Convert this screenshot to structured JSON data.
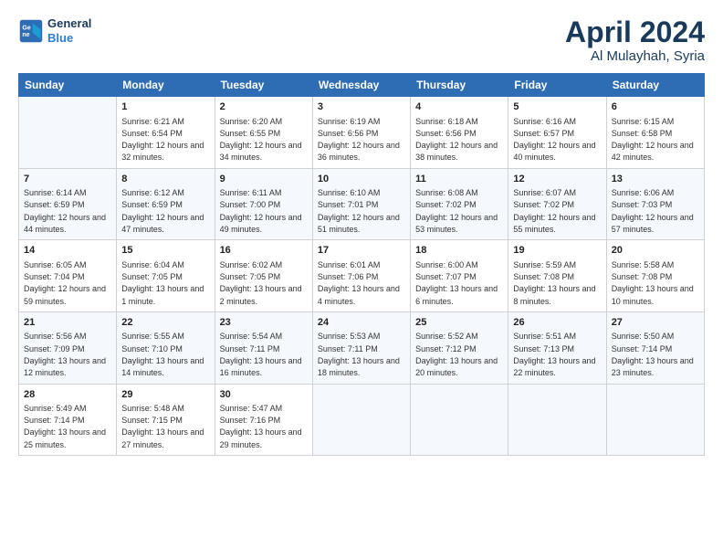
{
  "logo": {
    "line1": "General",
    "line2": "Blue"
  },
  "title": "April 2024",
  "subtitle": "Al Mulayhah, Syria",
  "days_header": [
    "Sunday",
    "Monday",
    "Tuesday",
    "Wednesday",
    "Thursday",
    "Friday",
    "Saturday"
  ],
  "weeks": [
    [
      {
        "day": "",
        "sunrise": "",
        "sunset": "",
        "daylight": ""
      },
      {
        "day": "1",
        "sunrise": "Sunrise: 6:21 AM",
        "sunset": "Sunset: 6:54 PM",
        "daylight": "Daylight: 12 hours and 32 minutes."
      },
      {
        "day": "2",
        "sunrise": "Sunrise: 6:20 AM",
        "sunset": "Sunset: 6:55 PM",
        "daylight": "Daylight: 12 hours and 34 minutes."
      },
      {
        "day": "3",
        "sunrise": "Sunrise: 6:19 AM",
        "sunset": "Sunset: 6:56 PM",
        "daylight": "Daylight: 12 hours and 36 minutes."
      },
      {
        "day": "4",
        "sunrise": "Sunrise: 6:18 AM",
        "sunset": "Sunset: 6:56 PM",
        "daylight": "Daylight: 12 hours and 38 minutes."
      },
      {
        "day": "5",
        "sunrise": "Sunrise: 6:16 AM",
        "sunset": "Sunset: 6:57 PM",
        "daylight": "Daylight: 12 hours and 40 minutes."
      },
      {
        "day": "6",
        "sunrise": "Sunrise: 6:15 AM",
        "sunset": "Sunset: 6:58 PM",
        "daylight": "Daylight: 12 hours and 42 minutes."
      }
    ],
    [
      {
        "day": "7",
        "sunrise": "Sunrise: 6:14 AM",
        "sunset": "Sunset: 6:59 PM",
        "daylight": "Daylight: 12 hours and 44 minutes."
      },
      {
        "day": "8",
        "sunrise": "Sunrise: 6:12 AM",
        "sunset": "Sunset: 6:59 PM",
        "daylight": "Daylight: 12 hours and 47 minutes."
      },
      {
        "day": "9",
        "sunrise": "Sunrise: 6:11 AM",
        "sunset": "Sunset: 7:00 PM",
        "daylight": "Daylight: 12 hours and 49 minutes."
      },
      {
        "day": "10",
        "sunrise": "Sunrise: 6:10 AM",
        "sunset": "Sunset: 7:01 PM",
        "daylight": "Daylight: 12 hours and 51 minutes."
      },
      {
        "day": "11",
        "sunrise": "Sunrise: 6:08 AM",
        "sunset": "Sunset: 7:02 PM",
        "daylight": "Daylight: 12 hours and 53 minutes."
      },
      {
        "day": "12",
        "sunrise": "Sunrise: 6:07 AM",
        "sunset": "Sunset: 7:02 PM",
        "daylight": "Daylight: 12 hours and 55 minutes."
      },
      {
        "day": "13",
        "sunrise": "Sunrise: 6:06 AM",
        "sunset": "Sunset: 7:03 PM",
        "daylight": "Daylight: 12 hours and 57 minutes."
      }
    ],
    [
      {
        "day": "14",
        "sunrise": "Sunrise: 6:05 AM",
        "sunset": "Sunset: 7:04 PM",
        "daylight": "Daylight: 12 hours and 59 minutes."
      },
      {
        "day": "15",
        "sunrise": "Sunrise: 6:04 AM",
        "sunset": "Sunset: 7:05 PM",
        "daylight": "Daylight: 13 hours and 1 minute."
      },
      {
        "day": "16",
        "sunrise": "Sunrise: 6:02 AM",
        "sunset": "Sunset: 7:05 PM",
        "daylight": "Daylight: 13 hours and 2 minutes."
      },
      {
        "day": "17",
        "sunrise": "Sunrise: 6:01 AM",
        "sunset": "Sunset: 7:06 PM",
        "daylight": "Daylight: 13 hours and 4 minutes."
      },
      {
        "day": "18",
        "sunrise": "Sunrise: 6:00 AM",
        "sunset": "Sunset: 7:07 PM",
        "daylight": "Daylight: 13 hours and 6 minutes."
      },
      {
        "day": "19",
        "sunrise": "Sunrise: 5:59 AM",
        "sunset": "Sunset: 7:08 PM",
        "daylight": "Daylight: 13 hours and 8 minutes."
      },
      {
        "day": "20",
        "sunrise": "Sunrise: 5:58 AM",
        "sunset": "Sunset: 7:08 PM",
        "daylight": "Daylight: 13 hours and 10 minutes."
      }
    ],
    [
      {
        "day": "21",
        "sunrise": "Sunrise: 5:56 AM",
        "sunset": "Sunset: 7:09 PM",
        "daylight": "Daylight: 13 hours and 12 minutes."
      },
      {
        "day": "22",
        "sunrise": "Sunrise: 5:55 AM",
        "sunset": "Sunset: 7:10 PM",
        "daylight": "Daylight: 13 hours and 14 minutes."
      },
      {
        "day": "23",
        "sunrise": "Sunrise: 5:54 AM",
        "sunset": "Sunset: 7:11 PM",
        "daylight": "Daylight: 13 hours and 16 minutes."
      },
      {
        "day": "24",
        "sunrise": "Sunrise: 5:53 AM",
        "sunset": "Sunset: 7:11 PM",
        "daylight": "Daylight: 13 hours and 18 minutes."
      },
      {
        "day": "25",
        "sunrise": "Sunrise: 5:52 AM",
        "sunset": "Sunset: 7:12 PM",
        "daylight": "Daylight: 13 hours and 20 minutes."
      },
      {
        "day": "26",
        "sunrise": "Sunrise: 5:51 AM",
        "sunset": "Sunset: 7:13 PM",
        "daylight": "Daylight: 13 hours and 22 minutes."
      },
      {
        "day": "27",
        "sunrise": "Sunrise: 5:50 AM",
        "sunset": "Sunset: 7:14 PM",
        "daylight": "Daylight: 13 hours and 23 minutes."
      }
    ],
    [
      {
        "day": "28",
        "sunrise": "Sunrise: 5:49 AM",
        "sunset": "Sunset: 7:14 PM",
        "daylight": "Daylight: 13 hours and 25 minutes."
      },
      {
        "day": "29",
        "sunrise": "Sunrise: 5:48 AM",
        "sunset": "Sunset: 7:15 PM",
        "daylight": "Daylight: 13 hours and 27 minutes."
      },
      {
        "day": "30",
        "sunrise": "Sunrise: 5:47 AM",
        "sunset": "Sunset: 7:16 PM",
        "daylight": "Daylight: 13 hours and 29 minutes."
      },
      {
        "day": "",
        "sunrise": "",
        "sunset": "",
        "daylight": ""
      },
      {
        "day": "",
        "sunrise": "",
        "sunset": "",
        "daylight": ""
      },
      {
        "day": "",
        "sunrise": "",
        "sunset": "",
        "daylight": ""
      },
      {
        "day": "",
        "sunrise": "",
        "sunset": "",
        "daylight": ""
      }
    ]
  ]
}
